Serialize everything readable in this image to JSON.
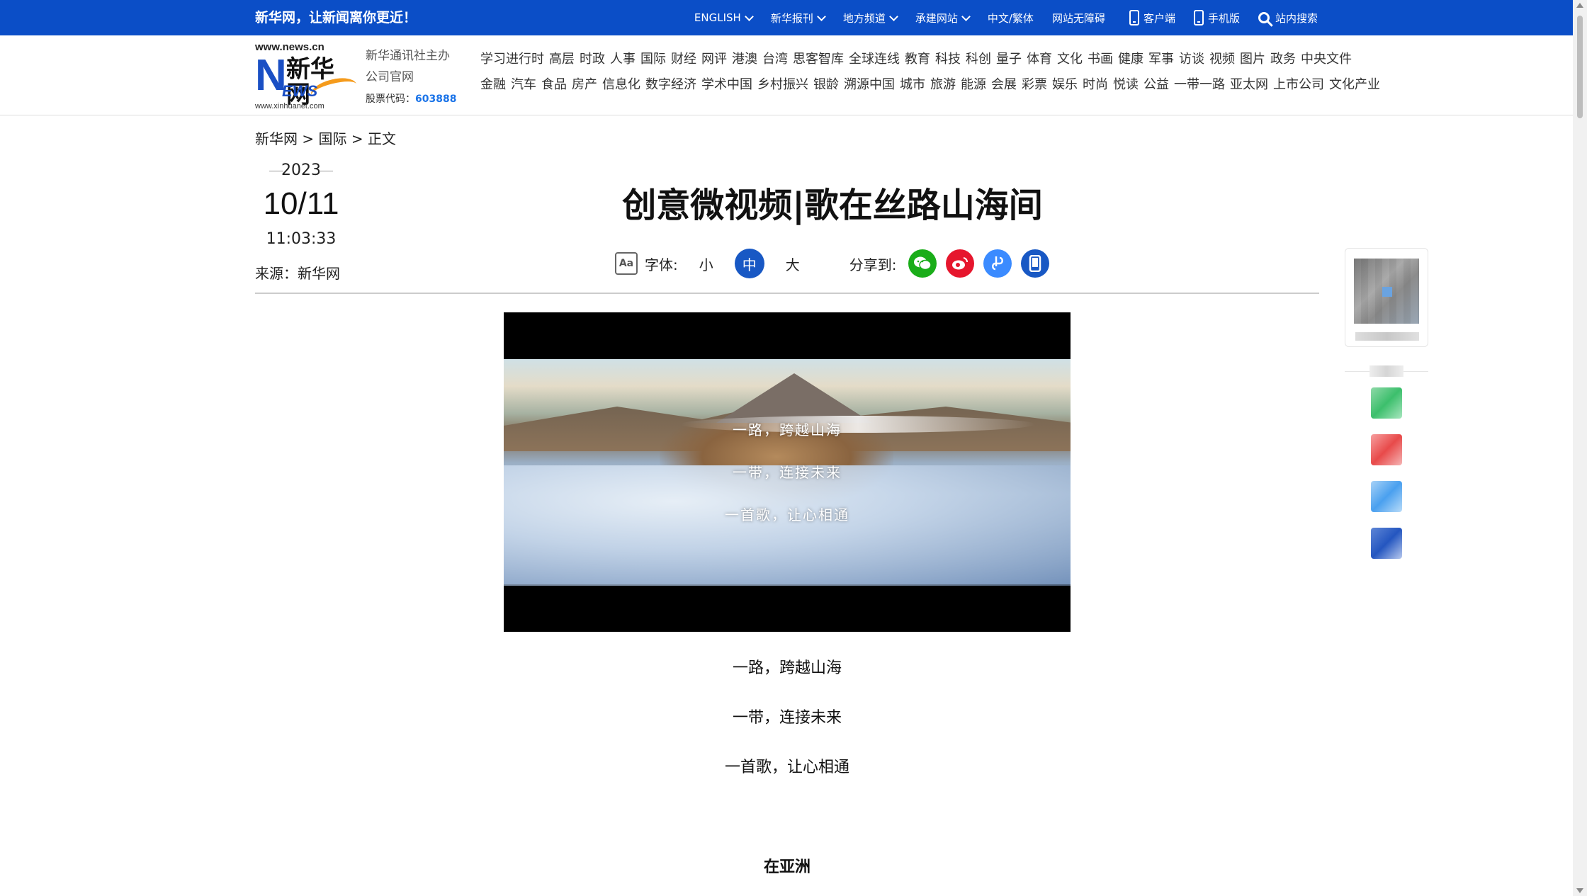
{
  "topbar": {
    "slogan": "新华网，让新闻离你更近！",
    "nav": [
      {
        "label": "ENGLISH",
        "dropdown": true
      },
      {
        "label": "新华报刊",
        "dropdown": true
      },
      {
        "label": "地方频道",
        "dropdown": true
      },
      {
        "label": "承建网站",
        "dropdown": true
      },
      {
        "label": "中文/繁体",
        "dropdown": false
      },
      {
        "label": "网站无障碍",
        "dropdown": false
      },
      {
        "label": "客户端",
        "icon": "phone-icon"
      },
      {
        "label": "手机版",
        "icon": "mobile-icon"
      },
      {
        "label": "站内搜索",
        "icon": "search-icon"
      }
    ]
  },
  "header": {
    "logo_url": "www.news.cn",
    "logo_letter": "N",
    "logo_cn": "新华网",
    "logo_ews": "EWS",
    "logo_sub": "www.xinhuanet.com",
    "company_line1": "新华通讯社主办",
    "company_line2": "公司官网",
    "stock_label": "股票代码：",
    "stock_code": "603888",
    "channels_row1": [
      "学习进行时",
      "高层",
      "时政",
      "人事",
      "国际",
      "财经",
      "网评",
      "港澳",
      "台湾",
      "思客智库",
      "全球连线",
      "教育",
      "科技",
      "科创",
      "量子",
      "体育",
      "文化",
      "书画",
      "健康",
      "军事",
      "访谈",
      "视频",
      "图片",
      "政务",
      "中央文件"
    ],
    "channels_row2": [
      "金融",
      "汽车",
      "食品",
      "房产",
      "信息化",
      "数字经济",
      "学术中国",
      "乡村振兴",
      "银龄",
      "溯源中国",
      "城市",
      "旅游",
      "能源",
      "会展",
      "彩票",
      "娱乐",
      "时尚",
      "悦读",
      "公益",
      "一带一路",
      "亚太网",
      "上市公司",
      "文化产业"
    ]
  },
  "breadcrumb": {
    "home": "新华网",
    "sep": ">",
    "section": "国际",
    "current": "正文"
  },
  "article": {
    "year": "2023",
    "month_day": "10/11",
    "time": "11:03:33",
    "source": "来源：新华网",
    "title": "创意微视频|歌在丝路山海间",
    "font_label": "字体:",
    "font_small": "小",
    "font_medium": "中",
    "font_large": "大",
    "share_label": "分享到:",
    "video_lines": [
      "一路，跨越山海",
      "一带，连接未来",
      "一首歌，让心相通"
    ],
    "paragraphs": [
      "一路，跨越山海",
      "一带，连接未来",
      "一首歌，让心相通"
    ],
    "subheading": "在亚洲"
  },
  "colors": {
    "brand_blue": "#0b4ec7",
    "wechat": "#1aad19",
    "weibo": "#e6162d",
    "link_share": "#3b8bff",
    "mobile_share": "#1858c4"
  }
}
